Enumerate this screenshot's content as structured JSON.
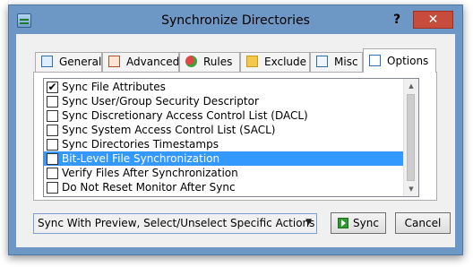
{
  "window": {
    "title": "Synchronize Directories",
    "help_glyph": "?",
    "close_glyph": "✕"
  },
  "tabs": [
    {
      "label": "General",
      "icon": "general-icon"
    },
    {
      "label": "Advanced",
      "icon": "advanced-icon"
    },
    {
      "label": "Rules",
      "icon": "rules-icon"
    },
    {
      "label": "Exclude",
      "icon": "exclude-icon"
    },
    {
      "label": "Misc",
      "icon": "misc-icon"
    },
    {
      "label": "Options",
      "icon": "options-icon",
      "active": true
    }
  ],
  "options_list": {
    "items": [
      {
        "label": "Sync File Attributes",
        "checked": true,
        "selected": false
      },
      {
        "label": "Sync User/Group Security Descriptor",
        "checked": false,
        "selected": false
      },
      {
        "label": "Sync Discretionary Access Control List (DACL)",
        "checked": false,
        "selected": false
      },
      {
        "label": "Sync System Access Control List (SACL)",
        "checked": false,
        "selected": false
      },
      {
        "label": "Sync Directories Timestamps",
        "checked": false,
        "selected": false
      },
      {
        "label": "Bit-Level File Synchronization",
        "checked": false,
        "selected": true
      },
      {
        "label": "Verify Files After Synchronization",
        "checked": false,
        "selected": false
      },
      {
        "label": "Do Not Reset Monitor After Sync",
        "checked": false,
        "selected": false
      }
    ],
    "check_glyph": "✔",
    "scroll_up_glyph": "▲",
    "scroll_down_glyph": "▼"
  },
  "footer": {
    "mode_select_value": "Sync With Preview, Select/Unselect Specific Actions",
    "dropdown_arrow_glyph": "▼",
    "sync_label": "Sync",
    "cancel_label": "Cancel"
  },
  "colors": {
    "titlebar": "#6d97c4",
    "close": "#c74c3c",
    "selection": "#3399ff"
  }
}
